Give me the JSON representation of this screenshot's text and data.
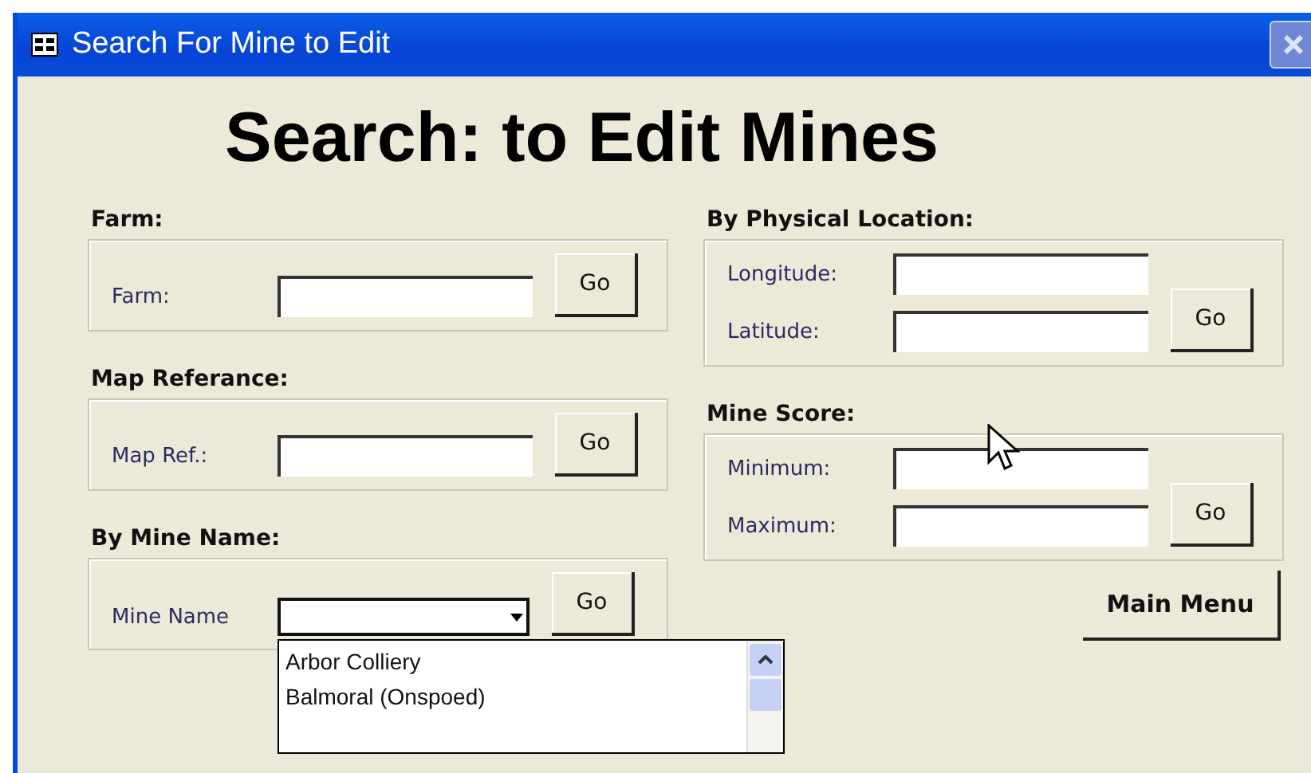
{
  "window": {
    "title": "Search For Mine to Edit"
  },
  "heading": "Search: to Edit Mines",
  "left_groups": [
    {
      "title": "Farm:",
      "fields": [
        {
          "label": "Farm:",
          "kind": "text"
        }
      ],
      "button": "Go"
    },
    {
      "title": "Map Referance:",
      "fields": [
        {
          "label": "Map Ref.:",
          "kind": "text"
        }
      ],
      "button": "Go"
    },
    {
      "title": "By Mine Name:",
      "fields": [
        {
          "label": "Mine Name",
          "kind": "combo",
          "expanded": true,
          "options": [
            "Arbor Colliery",
            "Balmoral (Onspoed)"
          ]
        }
      ],
      "button": "Go"
    }
  ],
  "right_groups": [
    {
      "title": "By Physical Location:",
      "fields": [
        {
          "label": "Longitude:",
          "kind": "text"
        },
        {
          "label": "Latitude:",
          "kind": "text"
        }
      ],
      "button": "Go"
    },
    {
      "title": "Mine Score:",
      "fields": [
        {
          "label": "Minimum:",
          "kind": "text"
        },
        {
          "label": "Maximum:",
          "kind": "text"
        }
      ],
      "button": "Go"
    }
  ],
  "main_menu_button": "Main Menu"
}
